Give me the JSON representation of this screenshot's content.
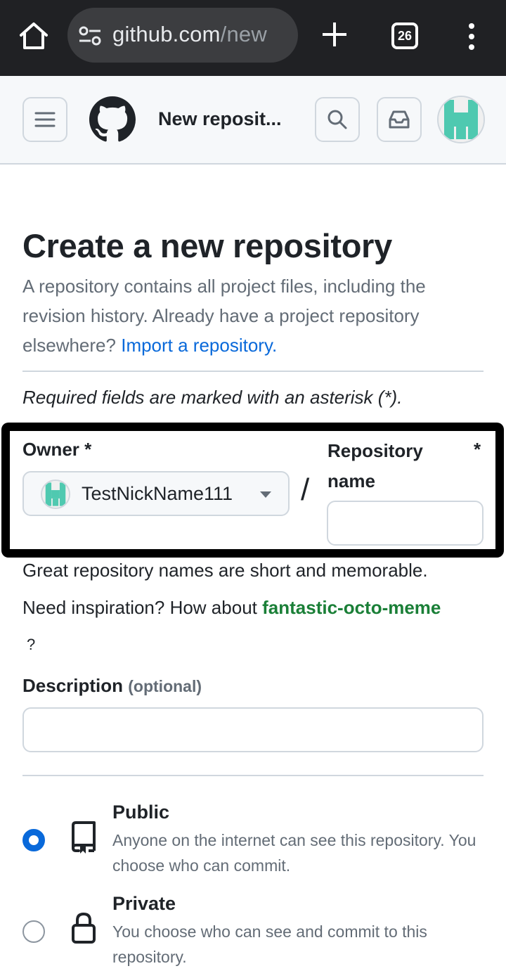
{
  "browser": {
    "url_host": "github.com",
    "url_path": "/new",
    "tab_count": "26"
  },
  "header": {
    "title": "New reposit..."
  },
  "main": {
    "heading": "Create a new repository",
    "intro_text": "A repository contains all project files, including the revision history. Already have a project repository elsewhere?",
    "import_link": "Import a repository.",
    "required_note": "Required fields are marked with an asterisk (*).",
    "owner_label": "Owner *",
    "owner_value": "TestNickName111",
    "slash": "/",
    "repo_name_label": "Repository name",
    "repo_name_asterisk": "*",
    "repo_name_value": "",
    "hint_short": "Great repository names are short and memorable.",
    "hint_inspiration_prefix": "Need inspiration? How about",
    "hint_suggestion": "fantastic-octo-meme",
    "hint_suffix": "?",
    "description_label": "Description",
    "description_optional": "(optional)",
    "description_value": "",
    "visibility": [
      {
        "title": "Public",
        "description": "Anyone on the internet can see this repository. You choose who can commit.",
        "selected": true,
        "icon": "repo-icon"
      },
      {
        "title": "Private",
        "description": "You choose who can see and commit to this repository.",
        "selected": false,
        "icon": "lock-icon"
      }
    ]
  },
  "colors": {
    "link": "#0969da",
    "suggestion": "#1a7f37",
    "avatar": "#4fc9b0"
  }
}
